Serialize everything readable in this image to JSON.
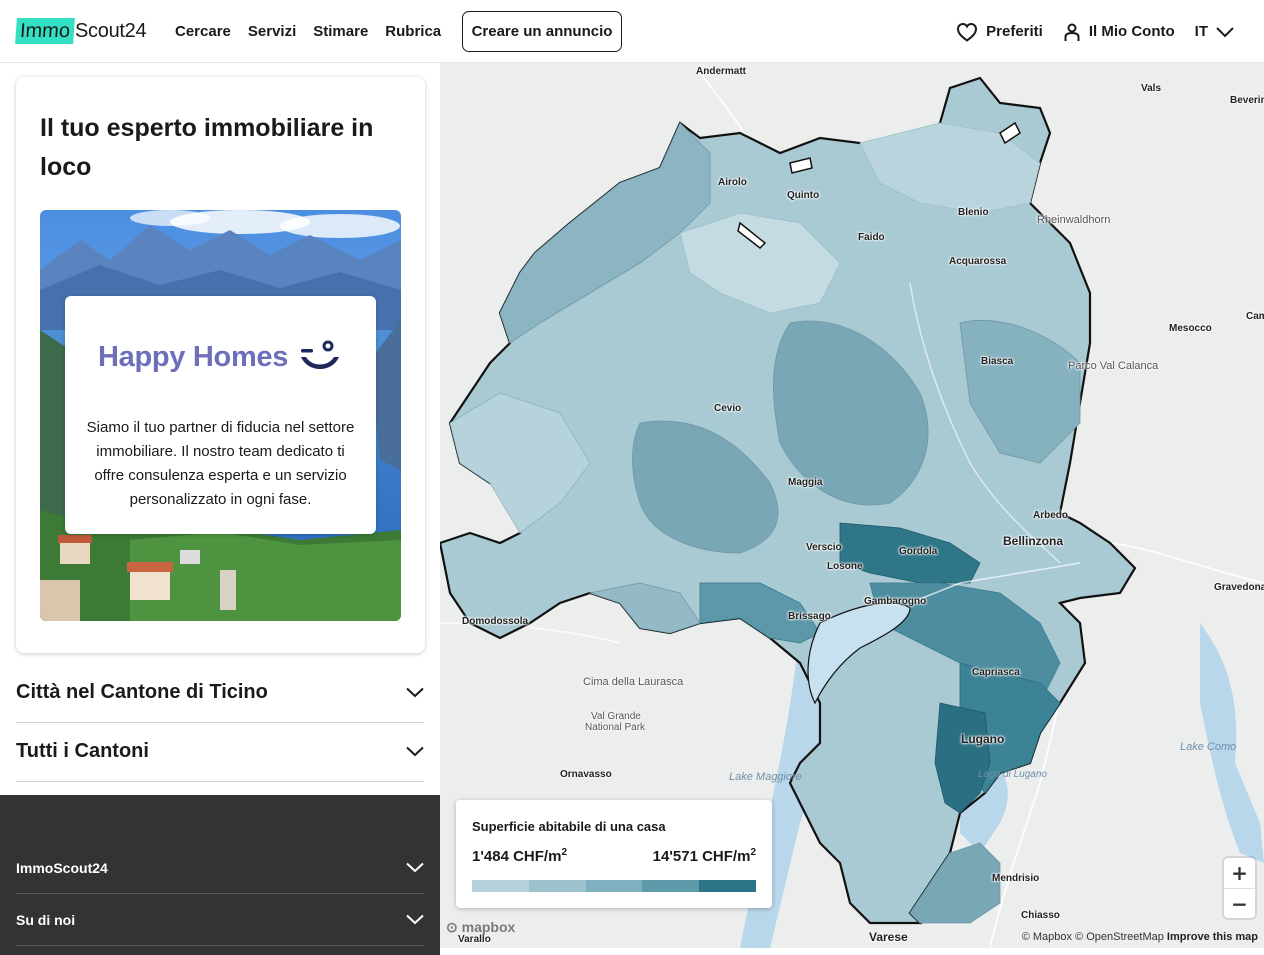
{
  "header": {
    "logo": {
      "part1": "Immo",
      "part2": "Scout24",
      "accent_color": "#33e0c4"
    },
    "nav": [
      "Cercare",
      "Servizi",
      "Stimare",
      "Rubrica"
    ],
    "cta_label": "Creare un annuncio",
    "favorites_label": "Preferiti",
    "account_label": "Il Mio Conto",
    "language_label": "IT",
    "icons": {
      "favorites": "heart-icon",
      "account": "user-icon",
      "language": "chevron-down-icon"
    }
  },
  "sidebar": {
    "card": {
      "title": "Il tuo esperto immobiliare in loco",
      "promo": {
        "brand_name": "Happy Homes",
        "brand_color": "#6d6fba",
        "description": "Siamo il tuo partner di fiducia nel settore immobiliare. Il nostro team dedicato ti offre consulenza esperta e un servizio personalizzato in ogni fase."
      }
    },
    "accordions": [
      {
        "label": "Città nel Cantone di Ticino"
      },
      {
        "label": "Tutti i Cantoni"
      }
    ],
    "footer": [
      {
        "label": "ImmoScout24"
      },
      {
        "label": "Su di noi"
      }
    ]
  },
  "map": {
    "places": {
      "andermatt": "Andermatt",
      "vals": "Vals",
      "beverin": "Beverin",
      "airolo": "Airolo",
      "quinto": "Quinto",
      "faido": "Faido",
      "blenio": "Blenio",
      "rheinwaldhorn": "Rheinwaldhorn",
      "acquarossa": "Acquarossa",
      "mesocco": "Mesocco",
      "cam": "Cam",
      "biasca": "Biasca",
      "parco": "Parco Val Calanca",
      "cevio": "Cevio",
      "maggia": "Maggia",
      "arbedo": "Arbedo",
      "bellinzona": "Bellinzona",
      "verscio": "Verscio",
      "gordola": "Gordola",
      "losone": "Losone",
      "gambarogno": "Gambarogno",
      "gravedona": "Gravedona",
      "brissago": "Brissago",
      "domodossola": "Domodossola",
      "capriasca": "Capriasca",
      "cima": "Cima della Laurasca",
      "valgrande1": "Val Grande",
      "valgrande2": "National Park",
      "lugano": "Lugano",
      "lake_como": "Lake Como",
      "ornavasso": "Ornavasso",
      "lake_maggiore": "Lake Maggiore",
      "lago_lugano": "Lago di Lugano",
      "mendrisio": "Mendrisio",
      "chiasso": "Chiasso",
      "varallo": "Varallo",
      "varese": "Varese"
    },
    "legend": {
      "title": "Superficie abitabile di una casa",
      "min": "1'484 CHF/m",
      "max": "14'571 CHF/m",
      "exponent": "2",
      "colors": [
        "#b4d1da",
        "#9cc2ce",
        "#7fb0bf",
        "#5f9aab",
        "#2e7488"
      ]
    },
    "zoom_in": "+",
    "zoom_out": "−",
    "mapbox_label": "mapbox",
    "attribution": "© Mapbox © OpenStreetMap",
    "improve": "Improve this map"
  }
}
